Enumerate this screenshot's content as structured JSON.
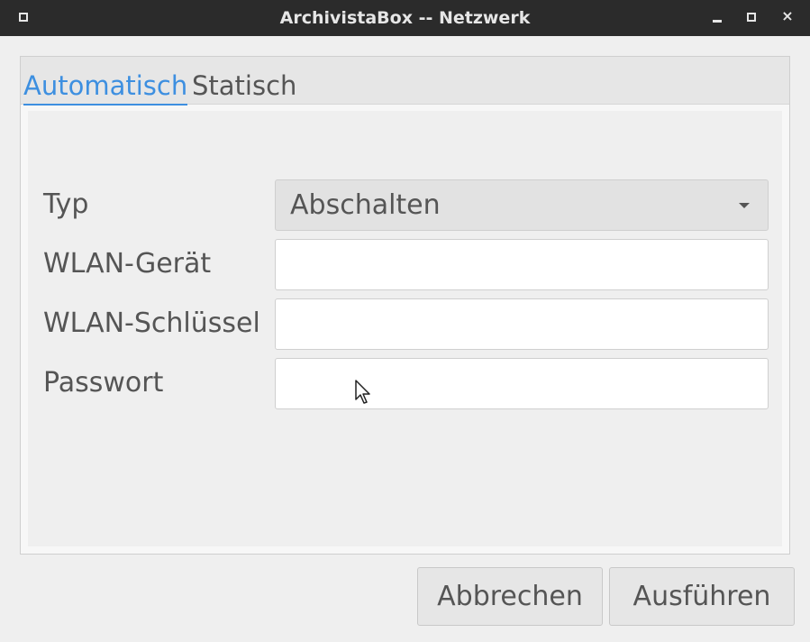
{
  "window": {
    "title": "ArchivistaBox -- Netzwerk",
    "close_symbol": "×"
  },
  "tabs": [
    {
      "label": "Automatisch",
      "active": true
    },
    {
      "label": "Statisch",
      "active": false
    }
  ],
  "form": {
    "type_label": "Typ",
    "type_value": "Abschalten",
    "wlan_device_label": "WLAN-Gerät",
    "wlan_device_value": "",
    "wlan_key_label": "WLAN-Schlüssel",
    "wlan_key_value": "",
    "password_label": "Passwort",
    "password_value": ""
  },
  "buttons": {
    "cancel": "Abbrechen",
    "run": "Ausführen"
  },
  "colors": {
    "accent": "#3d8fe0",
    "titlebar": "#2b2b2b"
  },
  "icons": [
    "window-menu-icon",
    "minimize-icon",
    "maximize-icon",
    "close-icon",
    "dropdown-caret-icon",
    "mouse-cursor-icon"
  ]
}
